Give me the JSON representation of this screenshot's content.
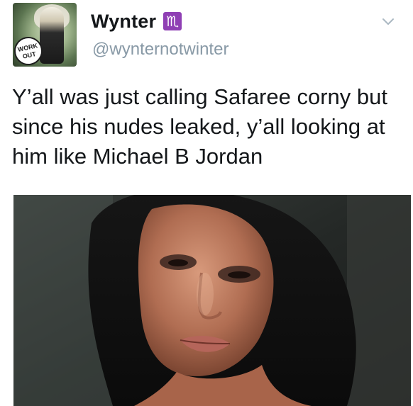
{
  "tweet": {
    "display_name": "Wynter",
    "zodiac_badge": "♏",
    "handle": "@wynternotwinter",
    "text": "Y’all was just calling Safaree corny but\nsince his nudes leaked, y’all looking at\nhim like Michael B Jordan",
    "avatar": {
      "stamp_text": "WORK OUT",
      "icon": "avatar-image"
    },
    "menu_icon": "chevron-down-icon",
    "media": {
      "type": "gif",
      "icon": "attached-media-image"
    },
    "colors": {
      "name": "#14171a",
      "handle": "#8899a6",
      "badge": "#8f3fb4"
    }
  }
}
